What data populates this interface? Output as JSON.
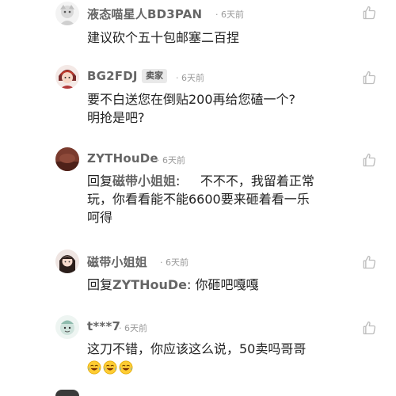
{
  "comments": [
    {
      "username": "液态喵星人BD3PAN",
      "time": "6天前",
      "text": "建议砍个五十包邮塞二百捏"
    },
    {
      "username": "BG2FDJ",
      "badge": "卖家",
      "time": "6天前",
      "text_line1": "要不白送您在倒贴200再给您磕一个?",
      "text_line2": "明抢是吧?"
    },
    {
      "username": "ZYTHouDe",
      "time": "6天前",
      "reply_prefix": "回复",
      "reply_to": "磁带小姐姐",
      "text_line1": ":     不不不，我留着正常",
      "text_line2": "玩，你看看能不能6600要来砸着看一乐",
      "text_line3": "呵得"
    },
    {
      "username": "磁带小姐姐",
      "time": "6天前",
      "reply_prefix": "回复",
      "reply_to": "ZYTHouDe",
      "text": ": 你砸吧嘎嘎"
    },
    {
      "username": "t***7",
      "time": "6天前",
      "text": "这刀不错，你应该这么说，50卖吗哥哥",
      "emojis": [
        "laugh-cry-emoji",
        "laugh-cry-emoji",
        "laugh-cry-emoji"
      ]
    }
  ],
  "icons": {
    "like": "thumbs-up-icon"
  },
  "colors": {
    "username": "#666666",
    "time": "#9a9a9a",
    "badge_bg": "#e9e9e9"
  }
}
